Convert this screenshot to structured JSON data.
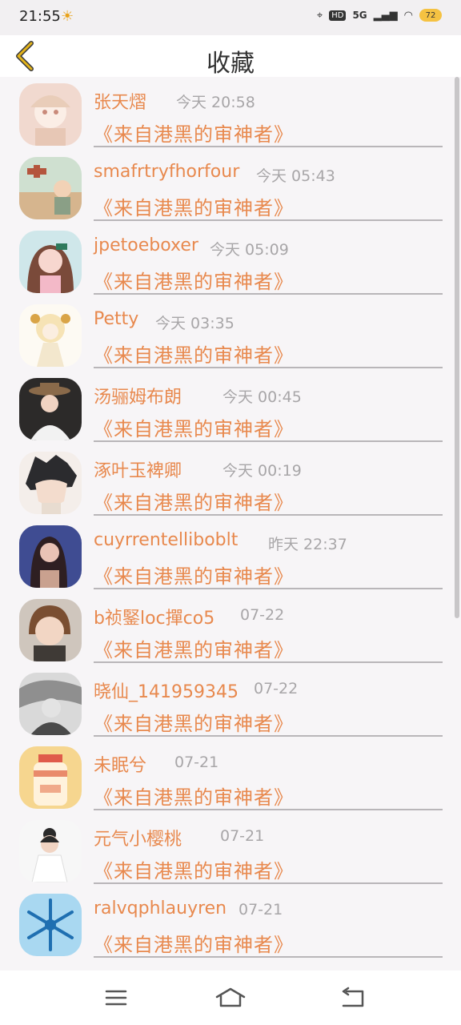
{
  "status_bar": {
    "time": "21:55",
    "network": "5G",
    "hd": "HD",
    "battery": "72"
  },
  "header": {
    "title": "收藏"
  },
  "items": [
    {
      "name": "张天熠",
      "time": "今天 20:58",
      "message": "《来自港黑的审神者》",
      "avatar_color": "#f1d9cf"
    },
    {
      "name": "smafrtryfhorfour",
      "time": "今天 05:43",
      "message": "《来自港黑的审神者》",
      "avatar_color": "#9bb9a5"
    },
    {
      "name": "jpetoeboxer",
      "time": "今天 05:09",
      "message": "《来自港黑的审神者》",
      "avatar_color": "#f2c1c8"
    },
    {
      "name": "Petty",
      "time": "今天 03:35",
      "message": "《来自港黑的审神者》",
      "avatar_color": "#fbf3e2"
    },
    {
      "name": "汤骊姆布朗",
      "time": "今天 00:45",
      "message": "《来自港黑的审神者》",
      "avatar_color": "#3b3633"
    },
    {
      "name": "涿叶玉裨卿",
      "time": "今天 00:19",
      "message": "《来自港黑的审神者》",
      "avatar_color": "#ece4df"
    },
    {
      "name": "cuyrrentelliboblt",
      "time": "昨天 22:37",
      "message": "《来自港黑的审神者》",
      "avatar_color": "#3d4a8a"
    },
    {
      "name": "b祯鋻loc撣co5",
      "time": "07-22",
      "message": "《来自港黑的审神者》",
      "avatar_color": "#b9ab9d"
    },
    {
      "name": "晓仙_141959345",
      "time": "07-22",
      "message": "《来自港黑的审神者》",
      "avatar_color": "#9a9a9a"
    },
    {
      "name": "未眠兮",
      "time": "07-21",
      "message": "《来自港黑的审神者》",
      "avatar_color": "#f3d390"
    },
    {
      "name": "元气小樱桃",
      "time": "07-21",
      "message": "《来自港黑的审神者》",
      "avatar_color": "#f4f4f4"
    },
    {
      "name": "ralvqphlauyren",
      "time": "07-21",
      "message": "《来自港黑的审神者》",
      "avatar_color": "#a6d5ef"
    }
  ],
  "icons": {
    "back": "chevron-left-icon",
    "menu": "menu-icon",
    "home": "home-icon",
    "return": "return-icon"
  },
  "colors": {
    "accent": "#e8894e",
    "muted": "#a8a6a8",
    "back_icon": "#e4b41a"
  }
}
